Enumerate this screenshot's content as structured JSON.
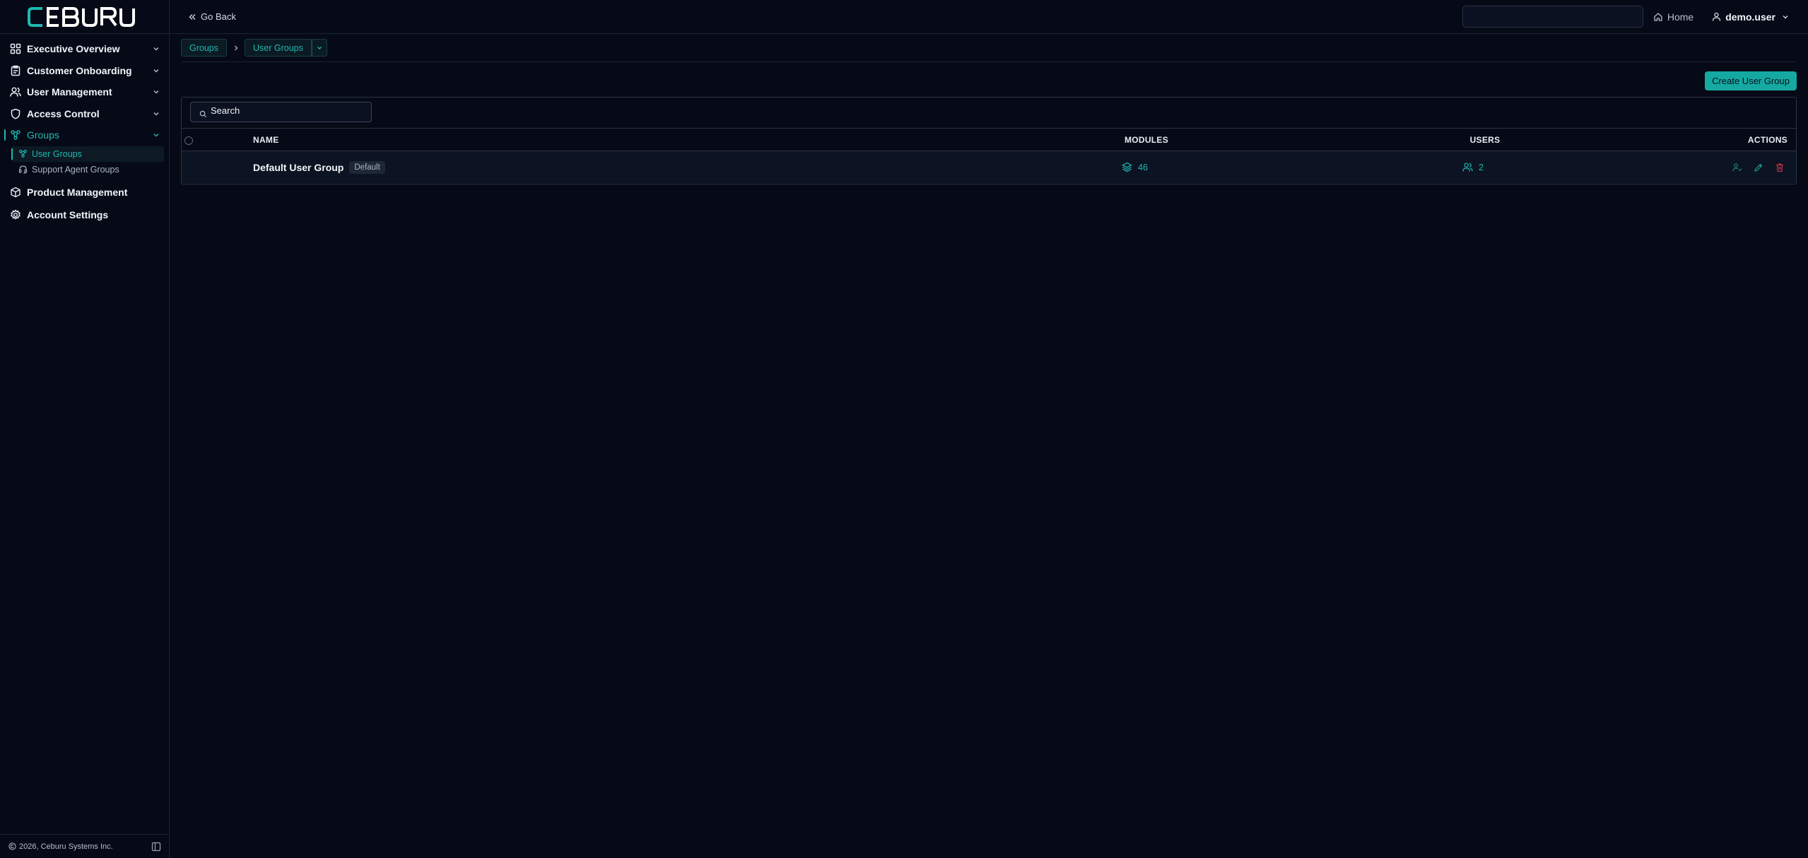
{
  "brand": {
    "logo_text": "CEBURU"
  },
  "colors": {
    "accent": "#1fb8b0",
    "background": "#060a17",
    "danger": "#c03545"
  },
  "sidebar": {
    "items": [
      {
        "label": "Executive Overview",
        "icon": "dashboard-grid-icon"
      },
      {
        "label": "Customer Onboarding",
        "icon": "clipboard-icon"
      },
      {
        "label": "User Management",
        "icon": "users-icon"
      },
      {
        "label": "Access Control",
        "icon": "shield-icon"
      },
      {
        "label": "Groups",
        "icon": "groups-icon",
        "active": true,
        "children": [
          {
            "label": "User Groups",
            "icon": "user-groups-icon",
            "active": true
          },
          {
            "label": "Support Agent Groups",
            "icon": "headset-icon"
          }
        ]
      },
      {
        "label": "Product Management",
        "icon": "box-icon"
      },
      {
        "label": "Account Settings",
        "icon": "gear-icon"
      }
    ],
    "footer": {
      "copyright": "2026, Ceburu Systems Inc."
    }
  },
  "topbar": {
    "back_label": "Go Back",
    "home_label": "Home",
    "user_label": "demo.user"
  },
  "breadcrumb": {
    "items": [
      "Groups",
      "User Groups"
    ]
  },
  "actions": {
    "create_label": "Create User Group"
  },
  "table": {
    "search_placeholder": "Search",
    "columns": {
      "name": "NAME",
      "modules": "MODULES",
      "users": "USERS",
      "actions": "ACTIONS"
    },
    "rows": [
      {
        "name": "Default User Group",
        "badge": "Default",
        "modules": "46",
        "users": "2"
      }
    ]
  }
}
